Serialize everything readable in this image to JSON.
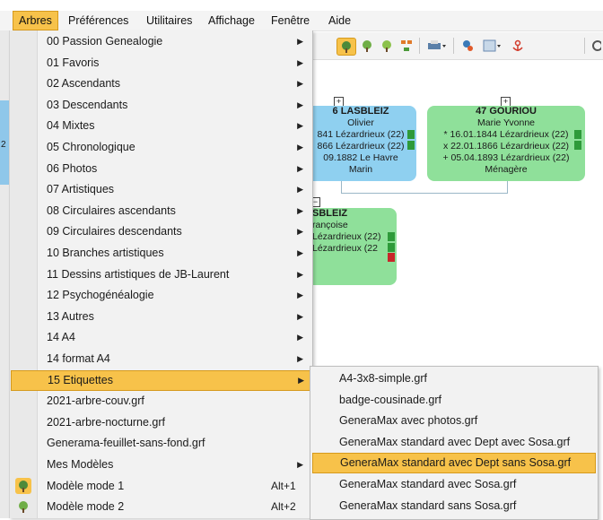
{
  "menubar": {
    "items": [
      "Arbres",
      "Préférences",
      "Utilitaires",
      "Affichage",
      "Fenêtre",
      "Aide"
    ]
  },
  "menu": {
    "items": [
      {
        "label": "00 Passion Genealogie",
        "submenu": true
      },
      {
        "label": "01 Favoris",
        "submenu": true
      },
      {
        "label": "02 Ascendants",
        "submenu": true
      },
      {
        "label": "03 Descendants",
        "submenu": true
      },
      {
        "label": "04 Mixtes",
        "submenu": true
      },
      {
        "label": "05 Chronologique",
        "submenu": true
      },
      {
        "label": "06 Photos",
        "submenu": true
      },
      {
        "label": "07 Artistiques",
        "submenu": true
      },
      {
        "label": "08 Circulaires ascendants",
        "submenu": true
      },
      {
        "label": "09 Circulaires descendants",
        "submenu": true
      },
      {
        "label": "10 Branches artistiques",
        "submenu": true
      },
      {
        "label": "11 Dessins artistiques de JB-Laurent",
        "submenu": true
      },
      {
        "label": "12 Psychogénéalogie",
        "submenu": true
      },
      {
        "label": "13 Autres",
        "submenu": true
      },
      {
        "label": "14 A4",
        "submenu": true
      },
      {
        "label": "14 format A4",
        "submenu": true
      },
      {
        "label": "15 Etiquettes",
        "submenu": true,
        "active": true
      },
      {
        "label": "2021-arbre-couv.grf",
        "submenu": false
      },
      {
        "label": "2021-arbre-nocturne.grf",
        "submenu": false
      },
      {
        "label": "Generama-feuillet-sans-fond.grf",
        "submenu": false
      },
      {
        "label": "Mes Modèles",
        "submenu": true
      },
      {
        "label": "Modèle mode 1",
        "submenu": false,
        "shortcut": "Alt+1",
        "icon": "tree-mode-1-icon"
      },
      {
        "label": "Modèle mode 2",
        "submenu": false,
        "shortcut": "Alt+2",
        "icon": "tree-mode-2-icon"
      }
    ]
  },
  "submenu": {
    "items": [
      {
        "label": "A4-3x8-simple.grf"
      },
      {
        "label": "badge-cousinade.grf"
      },
      {
        "label": "GeneraMax avec photos.grf"
      },
      {
        "label": "GeneraMax standard avec Dept avec Sosa.grf"
      },
      {
        "label": "GeneraMax standard avec Dept sans Sosa.grf",
        "active": true
      },
      {
        "label": "GeneraMax standard avec Sosa.grf"
      },
      {
        "label": "GeneraMax standard sans Sosa.grf"
      }
    ]
  },
  "tree": {
    "card_blue": {
      "name": "6 LASBLEIZ",
      "lines": [
        "Olivier",
        "841 Lézardrieux (22)",
        "866 Lézardrieux (22)",
        "09.1882 Le Havre",
        "Marin"
      ]
    },
    "card_green_top": {
      "name": "47 GOURIOU",
      "lines": [
        "Marie Yvonne",
        "* 16.01.1844 Lézardrieux (22)",
        "x 22.01.1866 Lézardrieux (22)",
        "+ 05.04.1893 Lézardrieux (22)",
        "Ménagère"
      ]
    },
    "card_green_bottom": {
      "name": "SBLEIZ",
      "lines": [
        "rançoise",
        "Lézardrieux (22)",
        "Lézardrieux (22"
      ]
    },
    "expand_plus": "+",
    "expand_minus": "−",
    "left_number": "2"
  },
  "colors": {
    "accent": "#f7c24a",
    "card_blue": "#8fd0f0",
    "card_green": "#8fe09a"
  }
}
